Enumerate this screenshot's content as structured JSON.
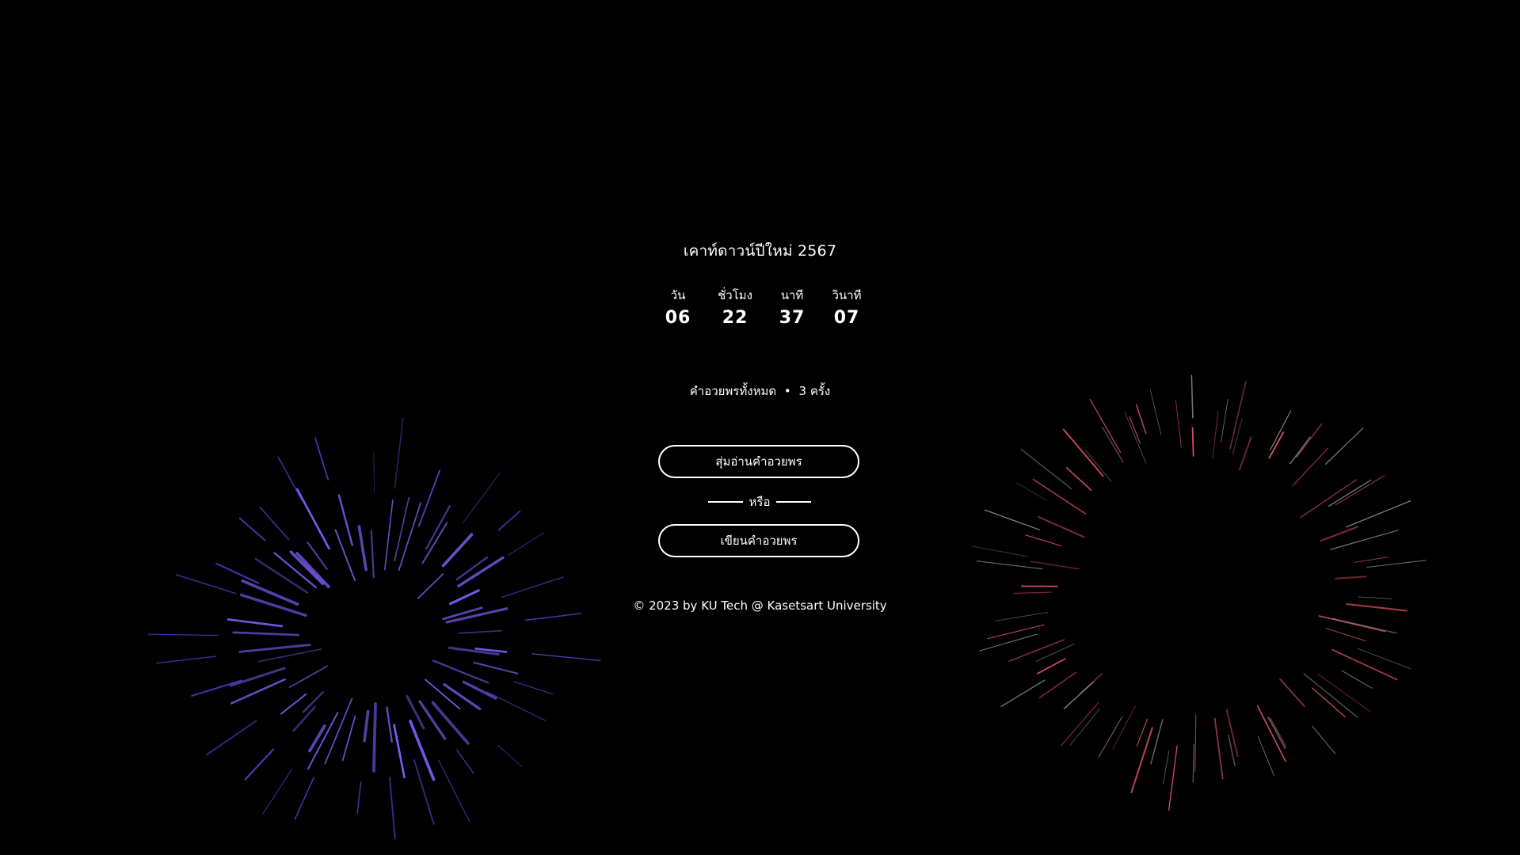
{
  "header": {
    "title": "เคาท์ดาวน์ปีใหม่ 2567"
  },
  "countdown": {
    "units": [
      {
        "label": "วัน",
        "value": "06"
      },
      {
        "label": "ชั่วโมง",
        "value": "22"
      },
      {
        "label": "นาที",
        "value": "37"
      },
      {
        "label": "วินาที",
        "value": "07"
      }
    ]
  },
  "wishes": {
    "label": "คำอวยพรทั้งหมด",
    "separator": "•",
    "count": "3",
    "unit": "ครั้ง"
  },
  "actions": {
    "random_label": "สุ่มอ่านคำอวยพร",
    "or_label": "หรือ",
    "write_label": "เขียนคำอวยพร"
  },
  "footer": {
    "copyright": "© 2023 by KU Tech @ Kasetsart University"
  },
  "colors": {
    "background": "#000000",
    "text": "#ffffff",
    "firework_left": "#7b5cf0",
    "firework_right": "#e0506a"
  }
}
